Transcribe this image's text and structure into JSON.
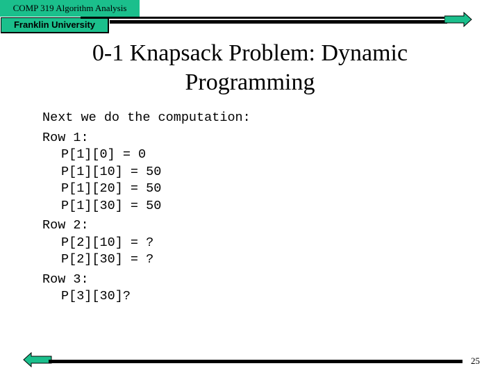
{
  "header": {
    "course_label": "COMP 319 Algorithm Analysis",
    "university_label": "Franklin University"
  },
  "navigation": {
    "next_icon": "right-arrow-icon",
    "prev_icon": "left-arrow-icon"
  },
  "colors": {
    "accent_teal": "#1bbf8c",
    "rule": "#000000"
  },
  "slide": {
    "title": "0-1 Knapsack Problem: Dynamic Programming",
    "title_line1": "0-1 Knapsack Problem: Dynamic",
    "title_line2": "Programming",
    "body": {
      "intro": "Next we do the computation:",
      "rows": [
        {
          "label": "Row 1:",
          "entries": [
            "P[1][0] = 0",
            "P[1][10] = 50",
            "P[1][20] = 50",
            "P[1][30] = 50"
          ]
        },
        {
          "label": "Row 2:",
          "entries": [
            "P[2][10] = ?",
            "P[2][30] = ?"
          ]
        },
        {
          "label": "Row 3:",
          "entries": [
            "P[3][30]?"
          ]
        }
      ]
    },
    "page_number": "25"
  }
}
